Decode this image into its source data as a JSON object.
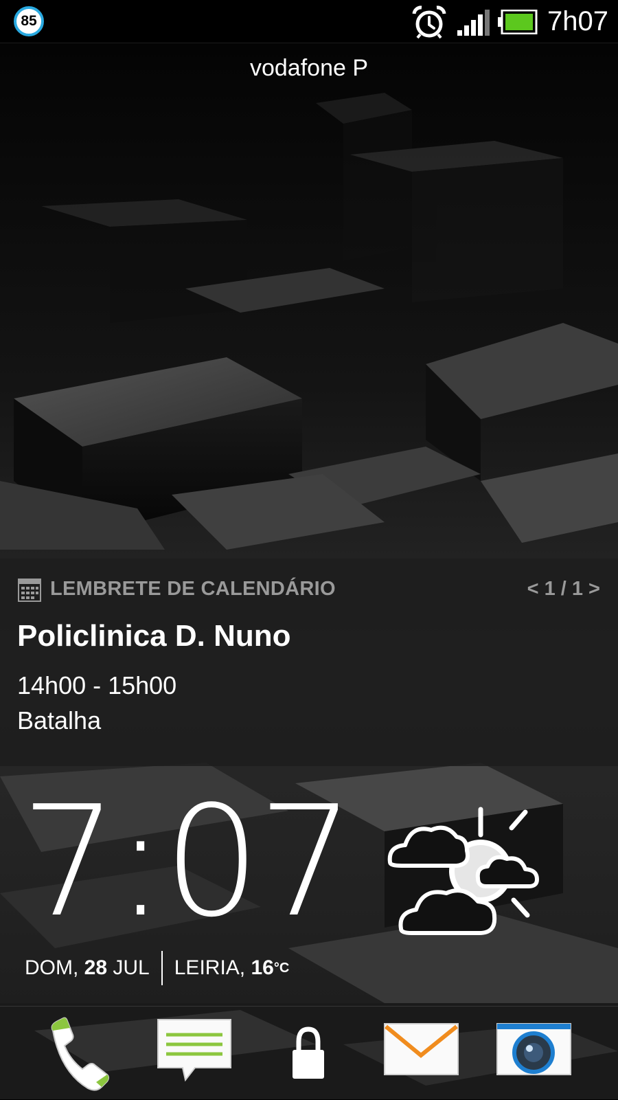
{
  "status_bar": {
    "badge_number": "85",
    "time": "7h07",
    "battery_color": "#5cc81e",
    "badge_ring_color": "#29a9e0",
    "icons": [
      "alarm-icon",
      "signal-icon",
      "battery-icon"
    ]
  },
  "carrier": "vodafone P",
  "reminder": {
    "header": "LEMBRETE DE CALENDÁRIO",
    "pager": "< 1 / 1 >",
    "title": "Policlinica D. Nuno",
    "time": "14h00 - 15h00",
    "location": "Batalha"
  },
  "clock": {
    "time": "7:07",
    "weekday": "DOM,",
    "day": "28",
    "month": "JUL",
    "city": "LEIRIA,",
    "temperature": "16",
    "unit": "°C",
    "weather_icon": "partly-cloudy-icon"
  },
  "dock": {
    "items": [
      "phone-icon",
      "messages-icon",
      "lock-icon",
      "mail-icon",
      "camera-icon"
    ],
    "accent_green": "#8cc63f",
    "mail_orange": "#f08c1e",
    "camera_blue": "#1e7fd0"
  }
}
